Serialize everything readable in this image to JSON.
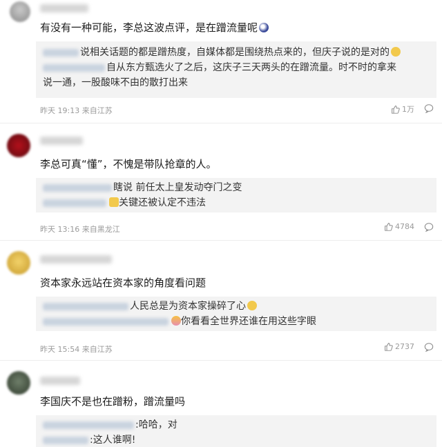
{
  "comments": [
    {
      "text": "有没有一种可能，李总这波点评，是在蹭流量呢",
      "replies": [
        {
          "text": "说相关话题的都是蹭热度，自媒体都是围绕热点来的，但庆子说的是对的"
        },
        {
          "text": "自从东方甄选火了之后，这庆子三天两头的在蹭流量。时不时的拿来"
        },
        {
          "text": "说一通，一股酸味不由的散打出来"
        }
      ],
      "time": "昨天 19:13 来自江苏",
      "likes": "1万"
    },
    {
      "text": "李总可真“懂”，不愧是带队抢章的人。",
      "replies": [
        {
          "text": "瞎说 前任太上皇发动夺门之变"
        },
        {
          "text": "关键还被认定不违法"
        }
      ],
      "time": "昨天 13:16 来自黑龙江",
      "likes": "4784"
    },
    {
      "text": "资本家永远站在资本家的角度看问题",
      "replies": [
        {
          "text": "人民总是为资本家操碎了心"
        },
        {
          "text": "你看看全世界还谁在用这些字眼"
        }
      ],
      "time": "昨天 15:54 来自江苏",
      "likes": "2737"
    },
    {
      "text": "李国庆不是也在蹭粉，蹭流量吗",
      "replies": [
        {
          "text": ":哈哈，对"
        },
        {
          "text": ":这人谁啊!"
        }
      ]
    }
  ],
  "colors": {
    "accent": "#eb7350",
    "meta": "#9a9a9a",
    "reply_bg": "#f3f3f3"
  },
  "icons": [
    "thumb-up-icon",
    "comment-icon",
    "emoji-icon"
  ]
}
